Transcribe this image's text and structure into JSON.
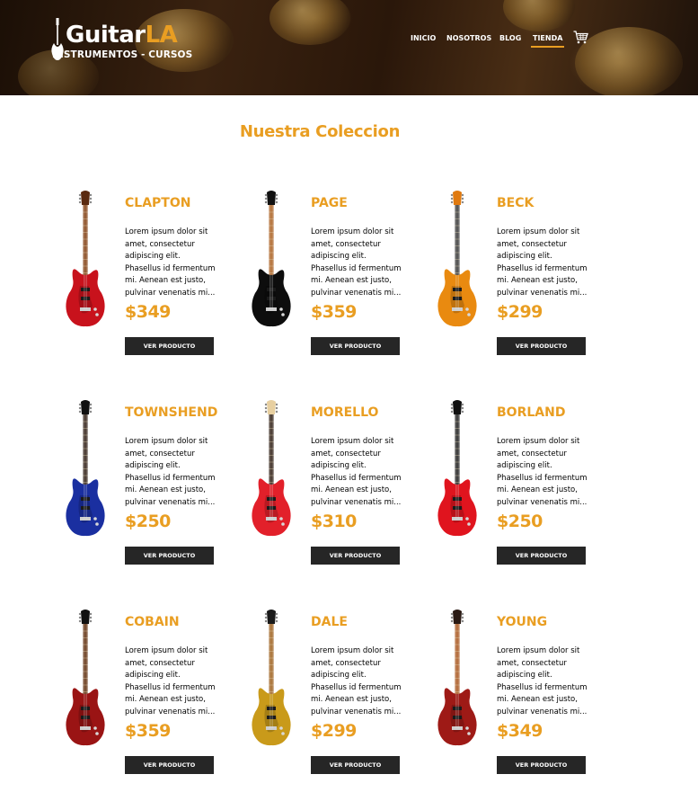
{
  "header": {
    "logo_title_main": "Guitar",
    "logo_title_accent": "LA",
    "logo_subtitle": "INSTRUMENTOS - CURSOS",
    "nav": [
      {
        "label": "INICIO"
      },
      {
        "label": "NOSOTROS"
      },
      {
        "label": "BLOG"
      },
      {
        "label": "TIENDA",
        "active": true
      }
    ],
    "cart_icon": "shopping-cart-icon"
  },
  "main": {
    "title": "Nuestra Coleccion",
    "button_label": "VER PRODUCTO",
    "products": [
      {
        "name": "CLAPTON",
        "price": "$349",
        "description": "Lorem ipsum dolor sit amet, consectetur adipiscing elit. Phasellus id fermentum mi. Aenean est justo, pulvinar venenatis mi...",
        "button": "VER PRODUCTO",
        "body_color": "#c8121c",
        "neck_color": "#8a4a1e",
        "head_color": "#5a2a10"
      },
      {
        "name": "PAGE",
        "price": "$359",
        "description": "Lorem ipsum dolor sit amet, consectetur adipiscing elit. Phasellus id fermentum mi. Aenean est justo, pulvinar venenatis mi...",
        "button": "VER PRODUCTO",
        "body_color": "#0d0d0d",
        "neck_color": "#b26a2e",
        "head_color": "#111111"
      },
      {
        "name": "BECK",
        "price": "$299",
        "description": "Lorem ipsum dolor sit amet, consectetur adipiscing elit. Phasellus id fermentum mi. Aenean est justo, pulvinar venenatis mi...",
        "button": "VER PRODUCTO",
        "body_color": "#e98a10",
        "neck_color": "#444444",
        "head_color": "#e07a10"
      },
      {
        "name": "TOWNSHEND",
        "price": "$250",
        "description": "Lorem ipsum dolor sit amet, consectetur adipiscing elit. Phasellus id fermentum mi. Aenean est justo, pulvinar venenatis mi...",
        "button": "VER PRODUCTO",
        "body_color": "#1a2fa0",
        "neck_color": "#3a2a20",
        "head_color": "#111111"
      },
      {
        "name": "MORELLO",
        "price": "$310",
        "description": "Lorem ipsum dolor sit amet, consectetur adipiscing elit. Phasellus id fermentum mi. Aenean est justo, pulvinar venenatis mi...",
        "button": "VER PRODUCTO",
        "body_color": "#e2202a",
        "neck_color": "#3a2a20",
        "head_color": "#e7cfa0"
      },
      {
        "name": "BORLAND",
        "price": "$250",
        "description": "Lorem ipsum dolor sit amet, consectetur adipiscing elit. Phasellus id fermentum mi. Aenean est justo, pulvinar venenatis mi...",
        "button": "VER PRODUCTO",
        "body_color": "#e0141e",
        "neck_color": "#2a2a2a",
        "head_color": "#111111"
      },
      {
        "name": "COBAIN",
        "price": "$359",
        "description": "Lorem ipsum dolor sit amet, consectetur adipiscing elit. Phasellus id fermentum mi. Aenean est justo, pulvinar venenatis mi...",
        "button": "VER PRODUCTO",
        "body_color": "#9a1414",
        "neck_color": "#6a3a1a",
        "head_color": "#111111"
      },
      {
        "name": "DALE",
        "price": "$299",
        "description": "Lorem ipsum dolor sit amet, consectetur adipiscing elit. Phasellus id fermentum mi. Aenean est justo, pulvinar venenatis mi...",
        "button": "VER PRODUCTO",
        "body_color": "#c99a1a",
        "neck_color": "#a56a2a",
        "head_color": "#1a1a1a"
      },
      {
        "name": "YOUNG",
        "price": "$349",
        "description": "Lorem ipsum dolor sit amet, consectetur adipiscing elit. Phasellus id fermentum mi. Aenean est justo, pulvinar venenatis mi...",
        "button": "VER PRODUCTO",
        "body_color": "#9e1a16",
        "neck_color": "#b0602a",
        "head_color": "#2a1a14"
      }
    ]
  },
  "colors": {
    "accent": "#e99e22",
    "button_bg": "#262626"
  }
}
